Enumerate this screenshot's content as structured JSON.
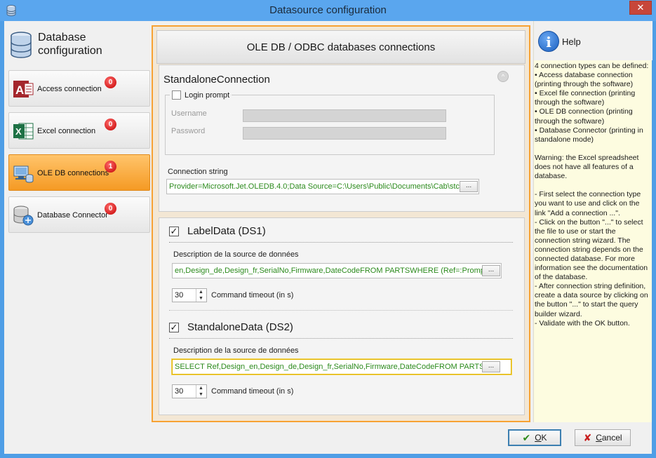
{
  "window": {
    "title": "Datasource configuration",
    "close_glyph": "✕"
  },
  "sidebar": {
    "header": "Database\nconfiguration",
    "items": [
      {
        "label": "Access connection",
        "badge": "0",
        "icon": "access-icon"
      },
      {
        "label": "Excel connection",
        "badge": "0",
        "icon": "excel-icon"
      },
      {
        "label": "OLE DB connections",
        "badge": "1",
        "icon": "oledb-icon",
        "active": true
      },
      {
        "label": "Database Connector",
        "badge": "0",
        "icon": "db-connector-icon"
      }
    ]
  },
  "main": {
    "title": "OLE DB / ODBC databases connections",
    "standalone": {
      "title": "StandaloneConnection",
      "collapse_glyph": "^",
      "login_prompt": "Login prompt",
      "username_label": "Username",
      "password_label": "Password",
      "connection_string_label": "Connection string",
      "connection_string": "Provider=Microsoft.Jet.OLEDB.4.0;Data Source=C:\\Users\\Public\\Documents\\Cab\\stc",
      "dots": "..."
    },
    "datasources": [
      {
        "title": "LabelData (DS1)",
        "checked": "✓",
        "desc_label": "Description de la source de données",
        "desc_value": "en,Design_de,Design_fr,SerialNo,Firmware,DateCodeFROM PARTSWHERE (Ref=:Prompte",
        "timeout": "30",
        "timeout_label": "Command timeout (in s)",
        "dots": "..."
      },
      {
        "title": "StandaloneData (DS2)",
        "checked": "✓",
        "desc_label": "Description de la source de données",
        "desc_value": "SELECT Ref,Design_en,Design_de,Design_fr,SerialNo,Firmware,DateCodeFROM PARTS",
        "timeout": "30",
        "timeout_label": "Command timeout (in s)",
        "dots": "..."
      }
    ]
  },
  "help": {
    "title": "Help",
    "icon_glyph": "i",
    "text": "4 connection types can be defined:\n• Access database connection (printing through the software)\n• Excel file connection (printing through the software)\n• OLE DB connection (printing through the software)\n• Database Connector (printing in standalone mode)\n\nWarning: the Excel spreadsheet does not have all features of a database.\n\n- First select the connection type you want to use and click on the link \"Add a connection ...\".\n- Click on the button \"...\" to select the file to use or start the connection string wizard. The connection string depends on the connected database. For more information see the documentation of the database.\n- After connection string definition, create a data source by clicking on the button \"...\" to start the query builder wizard.\n- Validate with the OK button."
  },
  "buttons": {
    "ok_mnemonic": "O",
    "ok_rest": "K",
    "ok_glyph": "✔",
    "cancel_mnemonic": "C",
    "cancel_rest": "ancel",
    "cancel_glyph": "✘"
  }
}
